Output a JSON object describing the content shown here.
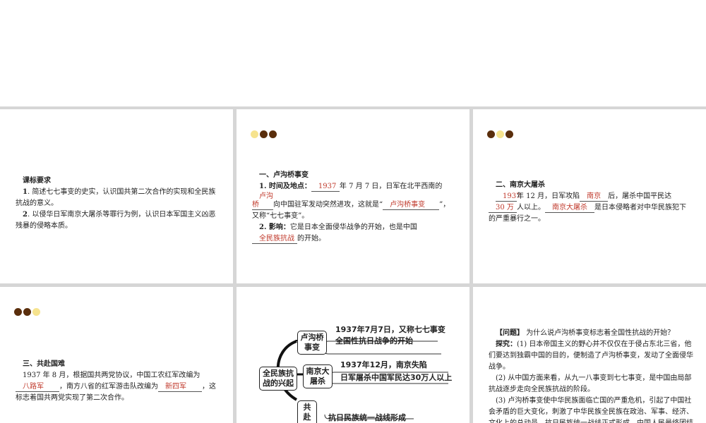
{
  "slide1": {
    "heading": "课标要求",
    "items": [
      {
        "num": "1",
        "text": ". 简述七七事变的史实，认识国共第二次合作的实现和全民族抗战的意义。"
      },
      {
        "num": "2",
        "text": ". 以侵华日军南京大屠杀等罪行为例，认识日本军国主义凶恶残暴的侵略本质。"
      }
    ]
  },
  "slide2": {
    "heading": "一、卢沟桥事变",
    "p1_label": "1. 时间及地点：",
    "p1_b1": "1937",
    "p1_t1": "年 7 月 7 日，日军在北平西南的",
    "p1_b2": "卢沟桥",
    "p1_t2": "向中国驻军发动突然进攻，这就是",
    "p1_b3": "卢沟桥事变",
    "p1_t3": "”，又称“七七事变”。",
    "p2_label": "2. 影响：",
    "p2_t1": "它是日本全面侵华战争的开始，也是中国",
    "p2_b1": "全民族抗战",
    "p2_t2": "的开始。"
  },
  "slide3": {
    "heading": "二、南京大屠杀",
    "b1": "1937",
    "t1": "年 12 月，日军攻陷",
    "b2": "南京",
    "t2": "后，屠杀中国平民达",
    "b3": "30 万",
    "t3": "人以上。",
    "b4": "南京大屠杀",
    "t4": "是日本侵略者对中华民族犯下的严重暴行之一。"
  },
  "slide4": {
    "heading": "三、共赴国难",
    "t1": "1937 年 8 月，根据国共两党协议，中国工农红军改编为",
    "b1": "八路军",
    "t2": "，南方八省的红军游击队改编为",
    "b2": "新四军",
    "t3": "，这标志着国共两党实现了第二次合作。"
  },
  "mindmap": {
    "root": "全民族抗战的兴起",
    "branches": [
      {
        "label": "卢沟桥事变",
        "leaves": [
          "1937年7月7日，又称七七事变",
          "全国性抗日战争的开始"
        ]
      },
      {
        "label": "南京大屠杀",
        "leaves": [
          "1937年12月，南京失陷",
          "日军屠杀中国军民达30万人以上"
        ]
      },
      {
        "label": "共赴国难",
        "leaves": [
          "抗日民族统一战线形成"
        ]
      }
    ]
  },
  "slide6": {
    "q_label": "【问题】",
    "question": "为什么说卢沟桥事变标志着全国性抗战的开始？",
    "ex_label": "探究：",
    "p1": "(1) 日本帝国主义的野心并不仅仅在于侵占东北三省，他们要达到独霸中国的目的，便制造了卢沟桥事变，发动了全面侵华战争。",
    "p2": "(2) 从中国方面来看，从九一八事变到七七事变，是中国由局部抗战逐步走向全民族抗战的阶段。",
    "p3": "(3) 卢沟桥事变使中华民族面临亡国的严重危机，引起了中国社会矛盾的巨大变化，刺激了中华民族全民族在政治、军事、经济、文化上的总动员，抗日民族统一战线正式形成，中国人民最终团结起来，进行了一场持久的全民族抗战。"
  }
}
